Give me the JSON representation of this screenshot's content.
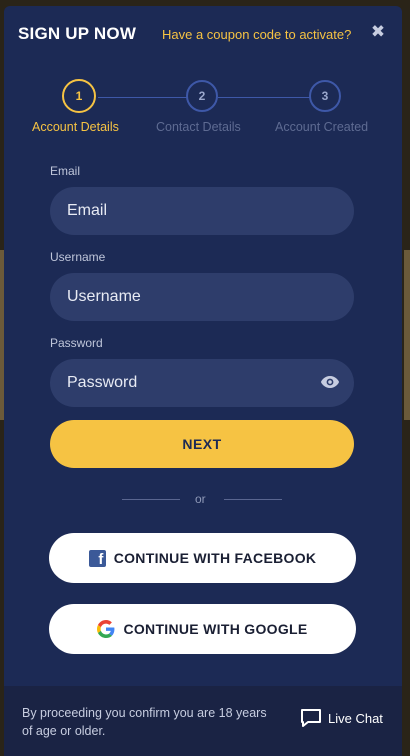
{
  "header": {
    "title": "SIGN UP NOW",
    "coupon_link": "Have a coupon code to activate?",
    "close_icon": "close-icon"
  },
  "stepper": {
    "steps": [
      {
        "number": "1",
        "label": "Account Details",
        "active": true
      },
      {
        "number": "2",
        "label": "Contact Details",
        "active": false
      },
      {
        "number": "3",
        "label": "Account Created",
        "active": false
      }
    ]
  },
  "form": {
    "email": {
      "label": "Email",
      "placeholder": "Email",
      "value": ""
    },
    "username": {
      "label": "Username",
      "placeholder": "Username",
      "value": ""
    },
    "password": {
      "label": "Password",
      "placeholder": "Password",
      "value": ""
    },
    "next_label": "NEXT",
    "divider_text": "or"
  },
  "social": {
    "facebook_label": "CONTINUE WITH FACEBOOK",
    "google_label": "CONTINUE WITH GOOGLE"
  },
  "footer": {
    "disclaimer": "By proceeding you confirm you are 18 years of age or older.",
    "chat_label": "Live Chat"
  },
  "colors": {
    "accent": "#f6c343",
    "background": "#1c2a55",
    "input_bg": "#2e3d6b",
    "facebook": "#3b5998"
  }
}
